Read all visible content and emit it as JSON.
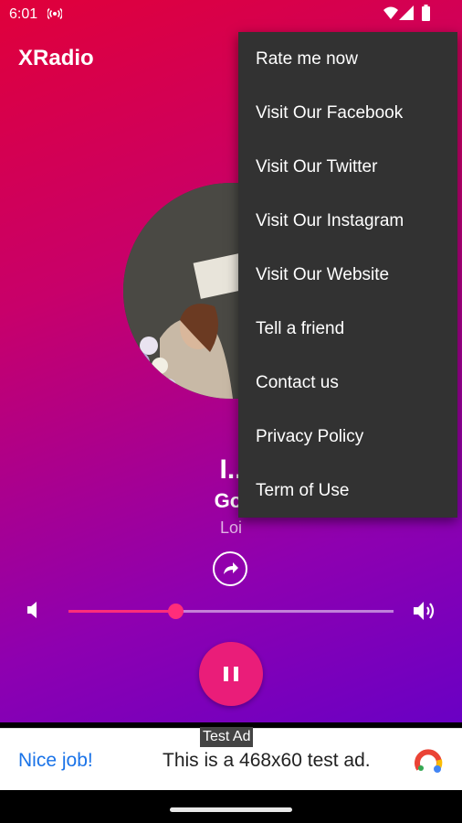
{
  "status_bar": {
    "time": "6:01",
    "icons": [
      "radio-broadcast-icon",
      "wifi-icon",
      "signal-icon",
      "battery-icon"
    ]
  },
  "app": {
    "title": "XRadio"
  },
  "player": {
    "song_title": "I..",
    "artist": "Gol",
    "station": "Loi",
    "volume_fraction": 0.33,
    "state": "playing",
    "accent_color": "#ea1d79"
  },
  "menu": {
    "items": [
      "Rate me now",
      "Visit Our Facebook",
      "Visit Our Twitter",
      "Visit Our Instagram",
      "Visit Our Website",
      "Tell a friend",
      "Contact us",
      "Privacy Policy",
      "Term of Use"
    ]
  },
  "ad": {
    "label": "Test Ad",
    "headline": "Nice job!",
    "text": "This is a 468x60 test ad."
  }
}
